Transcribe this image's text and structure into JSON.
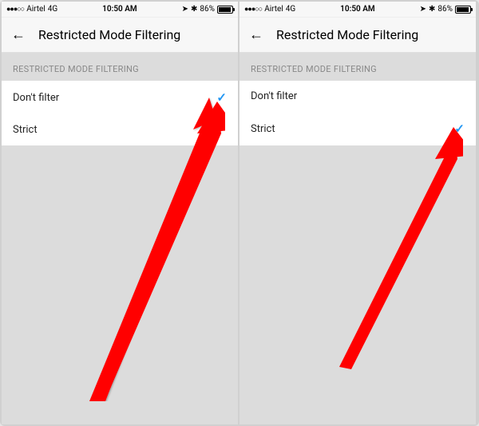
{
  "screens": [
    {
      "status": {
        "carrier": "Airtel",
        "network": "4G",
        "time": "10:50 AM",
        "battery_pct": "86%"
      },
      "header": {
        "title": "Restricted Mode Filtering"
      },
      "section_label": "RESTRICTED MODE FILTERING",
      "options": [
        {
          "label": "Don't filter",
          "selected": true
        },
        {
          "label": "Strict",
          "selected": false
        }
      ]
    },
    {
      "status": {
        "carrier": "Airtel",
        "network": "4G",
        "time": "10:50 AM",
        "battery_pct": "86%"
      },
      "header": {
        "title": "Restricted Mode Filtering"
      },
      "section_label": "RESTRICTED MODE FILTERING",
      "options": [
        {
          "label": "Don't filter",
          "selected": false
        },
        {
          "label": "Strict",
          "selected": true
        }
      ]
    }
  ]
}
